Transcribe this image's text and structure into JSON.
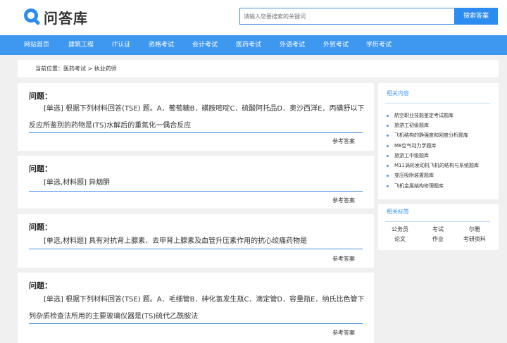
{
  "brand": {
    "name": "问答库",
    "accent": "#2d8cf0"
  },
  "search": {
    "placeholder": "请输入您要搜索的关键词",
    "button": "搜索答案"
  },
  "nav": [
    "网站首页",
    "建筑工程",
    "IT认证",
    "资格考试",
    "会计考试",
    "医药考试",
    "外语考试",
    "外贸考试",
    "学历考试"
  ],
  "breadcrumb": "当前位置：医药考试 > 执业药师",
  "questions": [
    {
      "title": "问题：",
      "text": "[单选] 根据下列材料回答(TSE) 题。A．葡萄糖B．磺胺嘧啶C．硫酸阿托品D．奥沙西洋E．丙磺舒以下反应所鉴别的药物是(TS)水解后的重氮化一偶合反应",
      "link": "参考答案"
    },
    {
      "title": "问题：",
      "text": "[单选,材料题] 异烟肼",
      "link": "参考答案"
    },
    {
      "title": "问题：",
      "text": "[单选,材料题] 具有对抗肾上腺素、去甲肾上腺素及血管升压素作用的抗心绞痛药物是",
      "link": "参考答案"
    },
    {
      "title": "问题：",
      "text": "[单选] 根据下列材料回答(TSE) 题。A．毛细管B．砷化氢发生瓶C．滴定管D．容量瓶E．纳氏比色管下列杂质检查法所用的主要玻璃仪器是(TS)硫代乙酰胺法",
      "link": "参考答案"
    }
  ],
  "related": {
    "title": "相关内容",
    "items": [
      "航空职业技能鉴定考试题库",
      "旅游工初级题库",
      "飞机结构的静强度和刚度分析题库",
      "M8空气动力学题库",
      "旅游工中级题库",
      "M11涡轮发动机飞机的结构与系统题库",
      "变压吸附装置题库",
      "飞机金属结构修理题库"
    ]
  },
  "tags": {
    "title": "相关标签",
    "items": [
      "公务员",
      "考试",
      "尔雅",
      "论文",
      "作业",
      "考研资料"
    ]
  }
}
